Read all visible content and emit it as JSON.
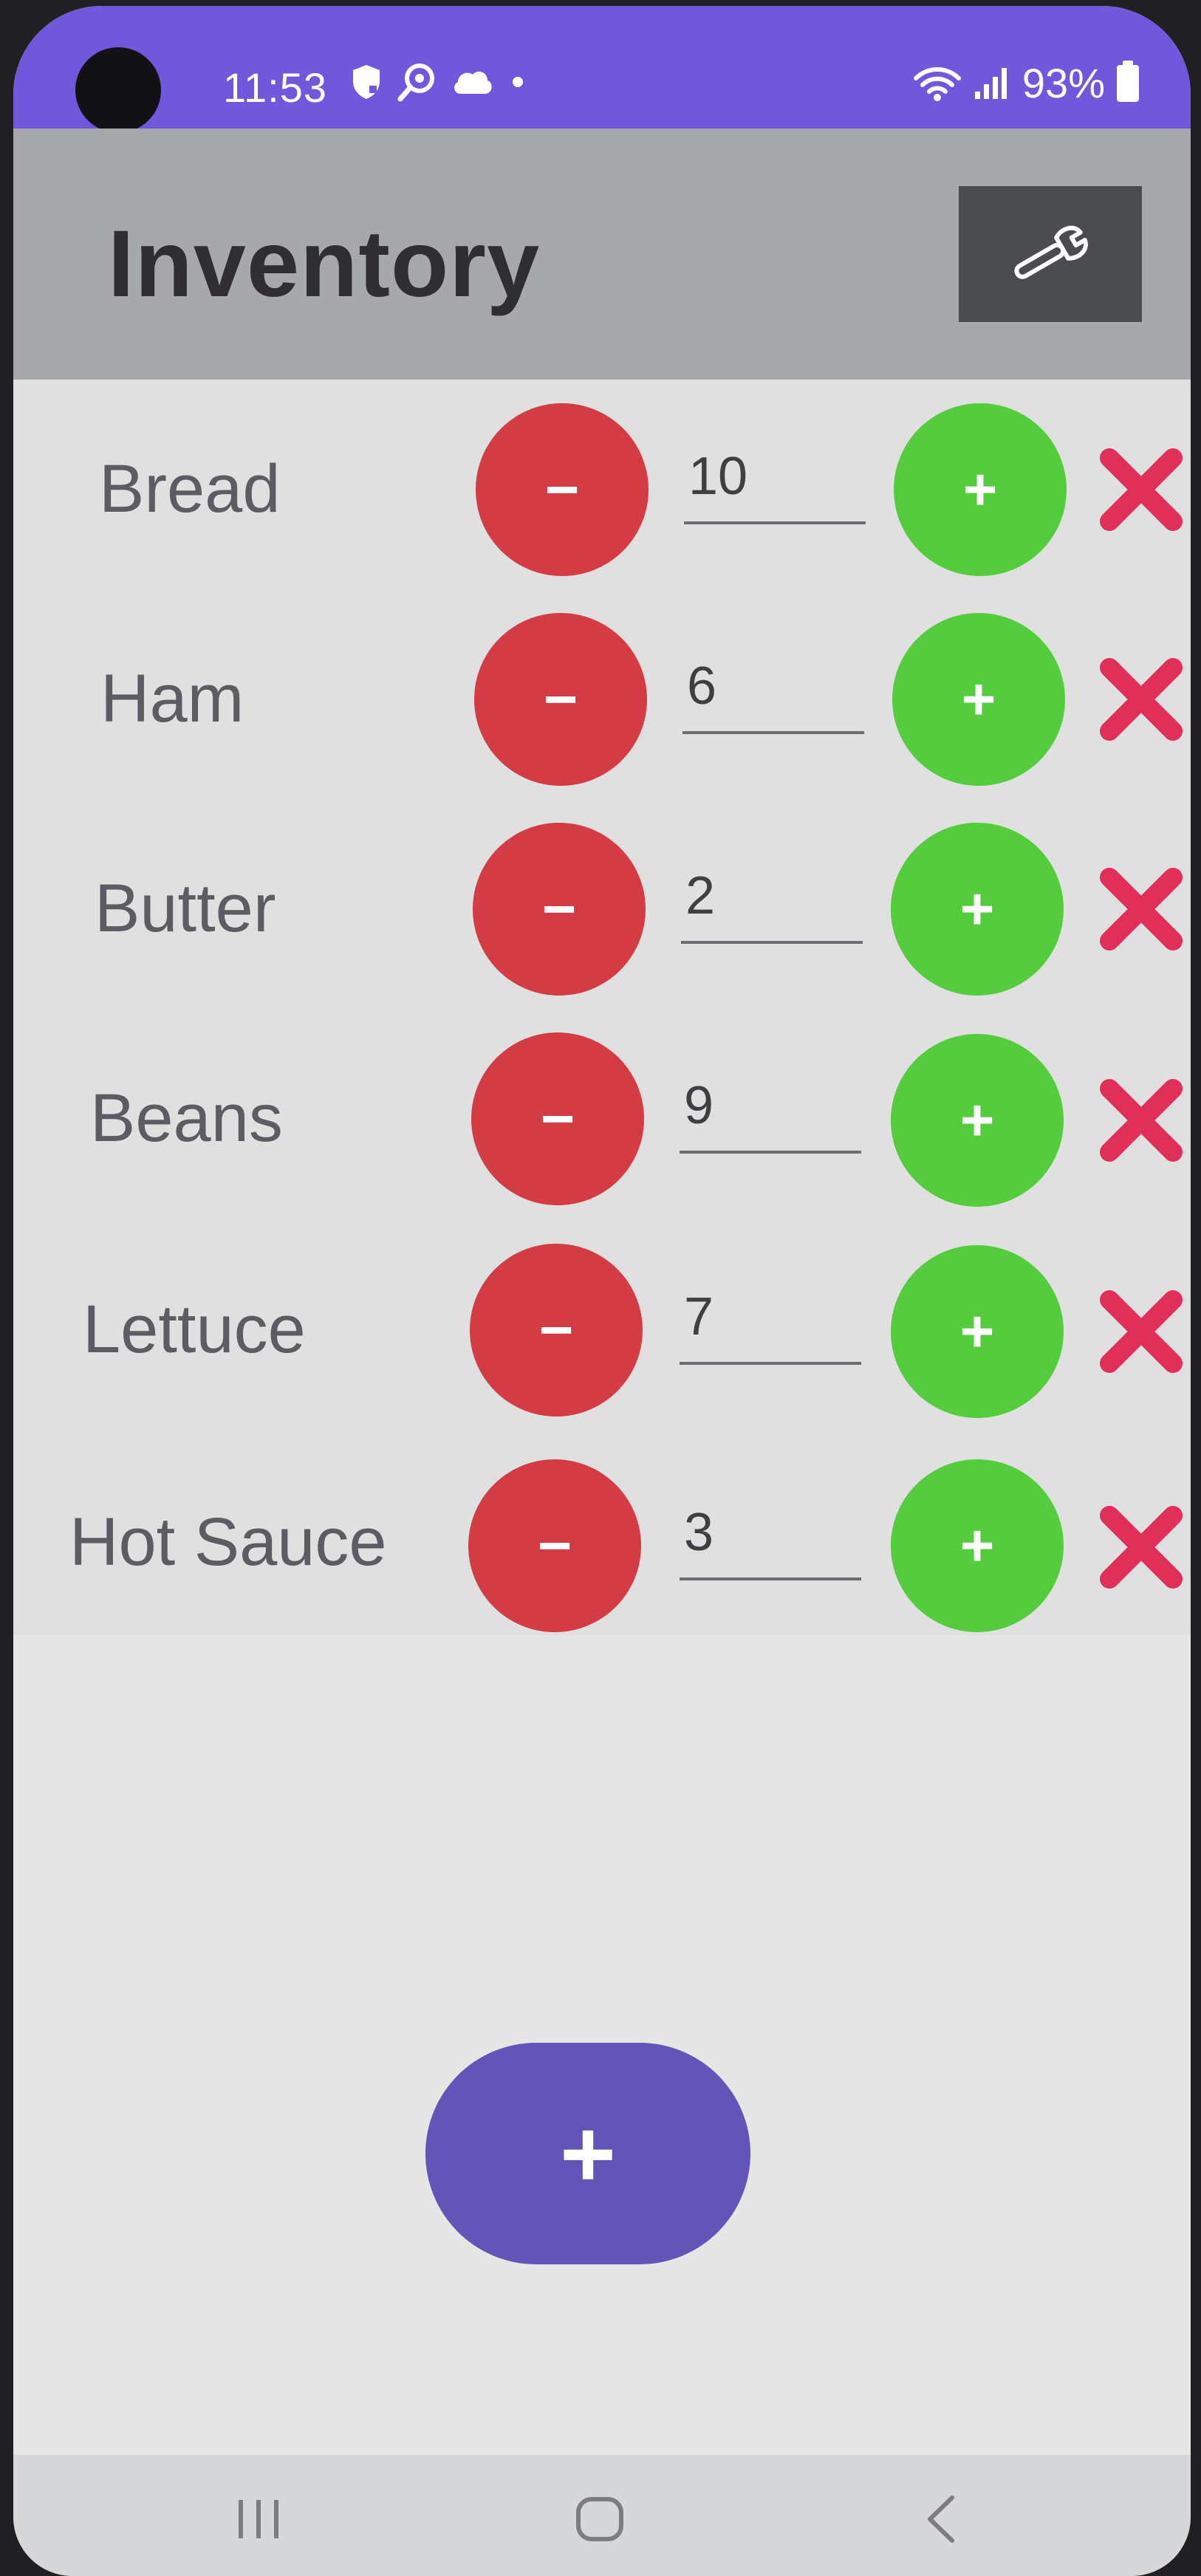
{
  "status_bar": {
    "time": "11:53",
    "battery_text": "93%",
    "icons_left": [
      "shield-icon",
      "search-target-icon",
      "cloud-icon",
      "dot-icon"
    ],
    "icons_right": [
      "wifi-icon",
      "signal-icon",
      "battery-icon"
    ]
  },
  "app_bar": {
    "title": "Inventory",
    "settings_icon": "wrench-icon"
  },
  "items": [
    {
      "name": "Bread",
      "quantity": "10"
    },
    {
      "name": "Ham",
      "quantity": "6"
    },
    {
      "name": "Butter",
      "quantity": "2"
    },
    {
      "name": "Beans",
      "quantity": "9"
    },
    {
      "name": "Lettuce",
      "quantity": "7"
    },
    {
      "name": "Hot Sauce",
      "quantity": "3"
    }
  ],
  "row_controls": {
    "minus_label": "−",
    "plus_label": "+",
    "delete_icon": "close-x-icon"
  },
  "fab": {
    "label": "+"
  },
  "nav_bar": {
    "buttons": [
      "recent-apps-icon",
      "home-icon",
      "back-icon"
    ]
  },
  "colors": {
    "status_bar": "#7057dc",
    "app_bar": "#a7a8ac",
    "minus": "#d33c44",
    "plus": "#55cc3e",
    "delete": "#e0305a",
    "fab": "#6155b8",
    "settings_button": "#4b4c4f"
  }
}
